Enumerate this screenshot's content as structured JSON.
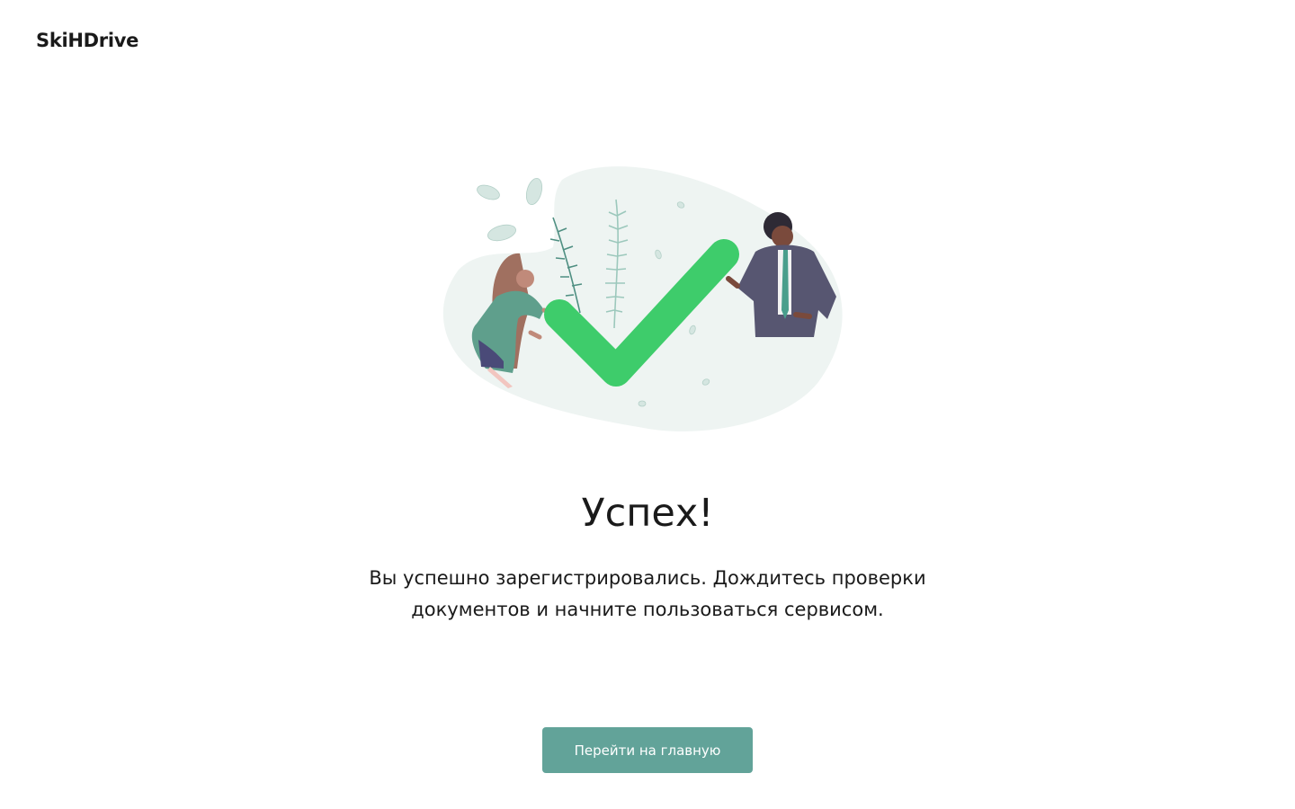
{
  "header": {
    "logo_text": "SkiHDrive"
  },
  "main": {
    "title": "Успех!",
    "message": "Вы успешно зарегистрировались. Дождитесь проверки документов и начните пользоваться сервисом.",
    "primary_button_label": "Перейти на главную"
  },
  "illustration": {
    "icon": "success-checkmark-illustration"
  },
  "colors": {
    "accent": "#62a399",
    "checkmark": "#3ecc6b",
    "blob": "#eef4f2",
    "text": "#1a1a1a"
  }
}
